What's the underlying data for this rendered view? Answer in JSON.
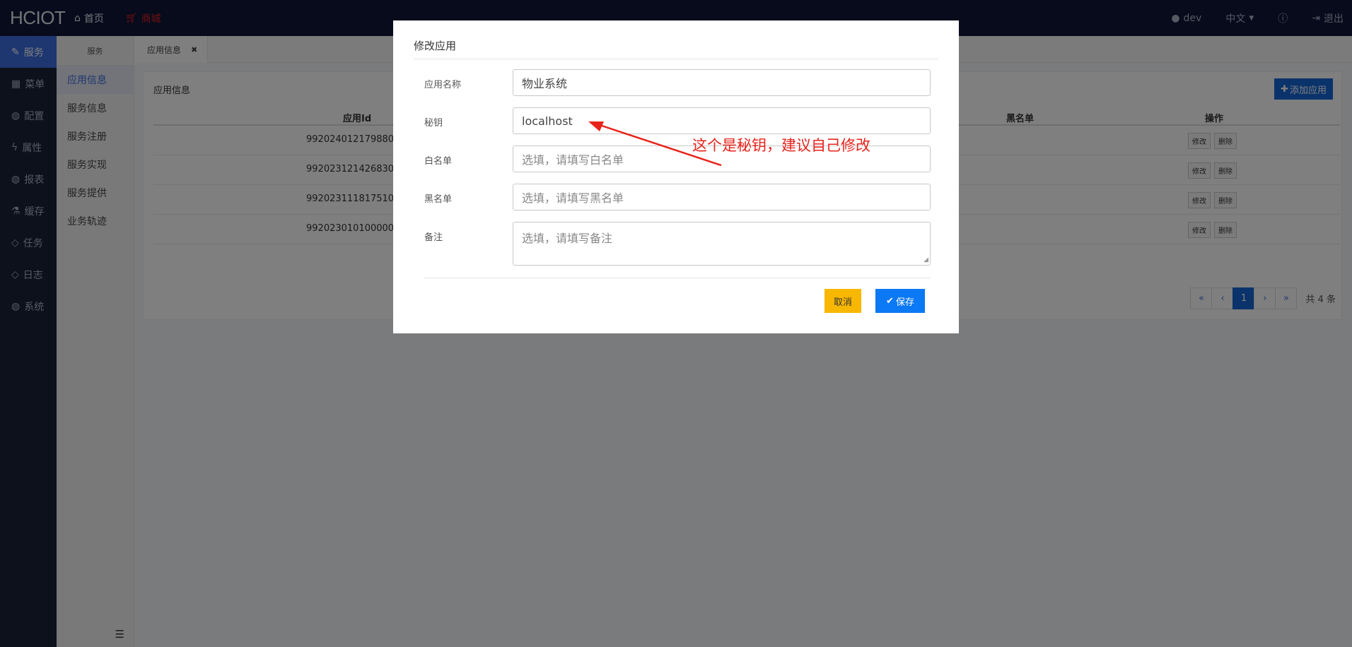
{
  "app": {
    "brand": "HCIOT"
  },
  "topnav": {
    "home": "首页",
    "shop": "商城"
  },
  "topright": {
    "user": "dev",
    "lang": "中文",
    "help": "",
    "logout": "退出"
  },
  "sidebar": {
    "items": [
      {
        "icon": "edit-icon",
        "label": "服务"
      },
      {
        "icon": "grid-icon",
        "label": "菜单"
      },
      {
        "icon": "globe-icon",
        "label": "配置"
      },
      {
        "icon": "bolt-icon",
        "label": "属性"
      },
      {
        "icon": "globe-icon",
        "label": "报表"
      },
      {
        "icon": "flask-icon",
        "label": "缓存"
      },
      {
        "icon": "diamond-icon",
        "label": "任务"
      },
      {
        "icon": "diamond-icon",
        "label": "日志"
      },
      {
        "icon": "globe-icon",
        "label": "系统"
      }
    ]
  },
  "submenu": {
    "header": "服务",
    "items": [
      "应用信息",
      "服务信息",
      "服务注册",
      "服务实现",
      "服务提供",
      "业务轨迹"
    ]
  },
  "tabs": [
    {
      "label": "应用信息",
      "close": "✖"
    }
  ],
  "card": {
    "title": "应用信息",
    "add_label": "添加应用"
  },
  "table": {
    "headers": {
      "id": "应用Id",
      "blacklist": "黑名单",
      "ops": "操作"
    },
    "rows": [
      {
        "id": "99202401217988000",
        "edit": "修改",
        "del": "删除"
      },
      {
        "id": "99202312142683001",
        "edit": "修改",
        "del": "删除"
      },
      {
        "id": "99202311181751000",
        "edit": "修改",
        "del": "删除"
      },
      {
        "id": "99202301010000000",
        "edit": "修改",
        "del": "删除"
      }
    ]
  },
  "pager": {
    "first": "«",
    "prev": "‹",
    "current": "1",
    "next": "›",
    "last": "»",
    "total": "共 4 条"
  },
  "modal": {
    "title": "修改应用",
    "fields": {
      "name": {
        "label": "应用名称",
        "value": "物业系统"
      },
      "secret": {
        "label": "秘钥",
        "value": "localhost"
      },
      "whitelist": {
        "label": "白名单",
        "placeholder": "选填，请填写白名单"
      },
      "blacklist": {
        "label": "黑名单",
        "placeholder": "选填，请填写黑名单"
      },
      "remark": {
        "label": "备注",
        "placeholder": "选填，请填写备注"
      }
    },
    "cancel": "取消",
    "save": "保存"
  },
  "annotation": {
    "text": "这个是秘钥，建议自己修改",
    "color": "#e8231b"
  }
}
